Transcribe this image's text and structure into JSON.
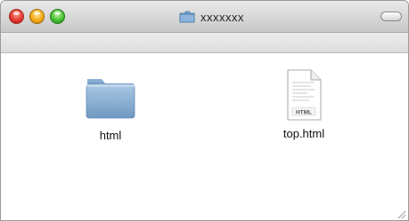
{
  "window": {
    "title": "xxxxxxx"
  },
  "items": [
    {
      "label": "html",
      "icon": "folder-icon"
    },
    {
      "label": "top.html",
      "icon": "html-document-icon",
      "badge": "HTML"
    }
  ],
  "colors": {
    "folder_blue": "#7aa3c9",
    "close": "#e0312a",
    "minimize": "#f0a713",
    "zoom": "#3fbb2b"
  }
}
